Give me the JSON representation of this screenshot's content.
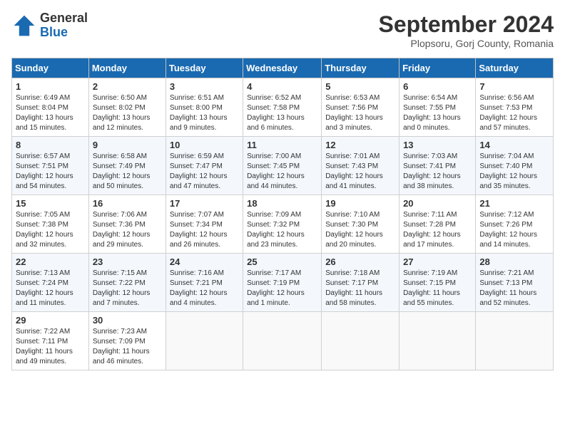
{
  "header": {
    "logo_general": "General",
    "logo_blue": "Blue",
    "title": "September 2024",
    "location": "Plopsoru, Gorj County, Romania"
  },
  "days_of_week": [
    "Sunday",
    "Monday",
    "Tuesday",
    "Wednesday",
    "Thursday",
    "Friday",
    "Saturday"
  ],
  "weeks": [
    [
      {
        "day": "1",
        "info": "Sunrise: 6:49 AM\nSunset: 8:04 PM\nDaylight: 13 hours and 15 minutes."
      },
      {
        "day": "2",
        "info": "Sunrise: 6:50 AM\nSunset: 8:02 PM\nDaylight: 13 hours and 12 minutes."
      },
      {
        "day": "3",
        "info": "Sunrise: 6:51 AM\nSunset: 8:00 PM\nDaylight: 13 hours and 9 minutes."
      },
      {
        "day": "4",
        "info": "Sunrise: 6:52 AM\nSunset: 7:58 PM\nDaylight: 13 hours and 6 minutes."
      },
      {
        "day": "5",
        "info": "Sunrise: 6:53 AM\nSunset: 7:56 PM\nDaylight: 13 hours and 3 minutes."
      },
      {
        "day": "6",
        "info": "Sunrise: 6:54 AM\nSunset: 7:55 PM\nDaylight: 13 hours and 0 minutes."
      },
      {
        "day": "7",
        "info": "Sunrise: 6:56 AM\nSunset: 7:53 PM\nDaylight: 12 hours and 57 minutes."
      }
    ],
    [
      {
        "day": "8",
        "info": "Sunrise: 6:57 AM\nSunset: 7:51 PM\nDaylight: 12 hours and 54 minutes."
      },
      {
        "day": "9",
        "info": "Sunrise: 6:58 AM\nSunset: 7:49 PM\nDaylight: 12 hours and 50 minutes."
      },
      {
        "day": "10",
        "info": "Sunrise: 6:59 AM\nSunset: 7:47 PM\nDaylight: 12 hours and 47 minutes."
      },
      {
        "day": "11",
        "info": "Sunrise: 7:00 AM\nSunset: 7:45 PM\nDaylight: 12 hours and 44 minutes."
      },
      {
        "day": "12",
        "info": "Sunrise: 7:01 AM\nSunset: 7:43 PM\nDaylight: 12 hours and 41 minutes."
      },
      {
        "day": "13",
        "info": "Sunrise: 7:03 AM\nSunset: 7:41 PM\nDaylight: 12 hours and 38 minutes."
      },
      {
        "day": "14",
        "info": "Sunrise: 7:04 AM\nSunset: 7:40 PM\nDaylight: 12 hours and 35 minutes."
      }
    ],
    [
      {
        "day": "15",
        "info": "Sunrise: 7:05 AM\nSunset: 7:38 PM\nDaylight: 12 hours and 32 minutes."
      },
      {
        "day": "16",
        "info": "Sunrise: 7:06 AM\nSunset: 7:36 PM\nDaylight: 12 hours and 29 minutes."
      },
      {
        "day": "17",
        "info": "Sunrise: 7:07 AM\nSunset: 7:34 PM\nDaylight: 12 hours and 26 minutes."
      },
      {
        "day": "18",
        "info": "Sunrise: 7:09 AM\nSunset: 7:32 PM\nDaylight: 12 hours and 23 minutes."
      },
      {
        "day": "19",
        "info": "Sunrise: 7:10 AM\nSunset: 7:30 PM\nDaylight: 12 hours and 20 minutes."
      },
      {
        "day": "20",
        "info": "Sunrise: 7:11 AM\nSunset: 7:28 PM\nDaylight: 12 hours and 17 minutes."
      },
      {
        "day": "21",
        "info": "Sunrise: 7:12 AM\nSunset: 7:26 PM\nDaylight: 12 hours and 14 minutes."
      }
    ],
    [
      {
        "day": "22",
        "info": "Sunrise: 7:13 AM\nSunset: 7:24 PM\nDaylight: 12 hours and 11 minutes."
      },
      {
        "day": "23",
        "info": "Sunrise: 7:15 AM\nSunset: 7:22 PM\nDaylight: 12 hours and 7 minutes."
      },
      {
        "day": "24",
        "info": "Sunrise: 7:16 AM\nSunset: 7:21 PM\nDaylight: 12 hours and 4 minutes."
      },
      {
        "day": "25",
        "info": "Sunrise: 7:17 AM\nSunset: 7:19 PM\nDaylight: 12 hours and 1 minute."
      },
      {
        "day": "26",
        "info": "Sunrise: 7:18 AM\nSunset: 7:17 PM\nDaylight: 11 hours and 58 minutes."
      },
      {
        "day": "27",
        "info": "Sunrise: 7:19 AM\nSunset: 7:15 PM\nDaylight: 11 hours and 55 minutes."
      },
      {
        "day": "28",
        "info": "Sunrise: 7:21 AM\nSunset: 7:13 PM\nDaylight: 11 hours and 52 minutes."
      }
    ],
    [
      {
        "day": "29",
        "info": "Sunrise: 7:22 AM\nSunset: 7:11 PM\nDaylight: 11 hours and 49 minutes."
      },
      {
        "day": "30",
        "info": "Sunrise: 7:23 AM\nSunset: 7:09 PM\nDaylight: 11 hours and 46 minutes."
      },
      {
        "day": "",
        "info": ""
      },
      {
        "day": "",
        "info": ""
      },
      {
        "day": "",
        "info": ""
      },
      {
        "day": "",
        "info": ""
      },
      {
        "day": "",
        "info": ""
      }
    ]
  ]
}
